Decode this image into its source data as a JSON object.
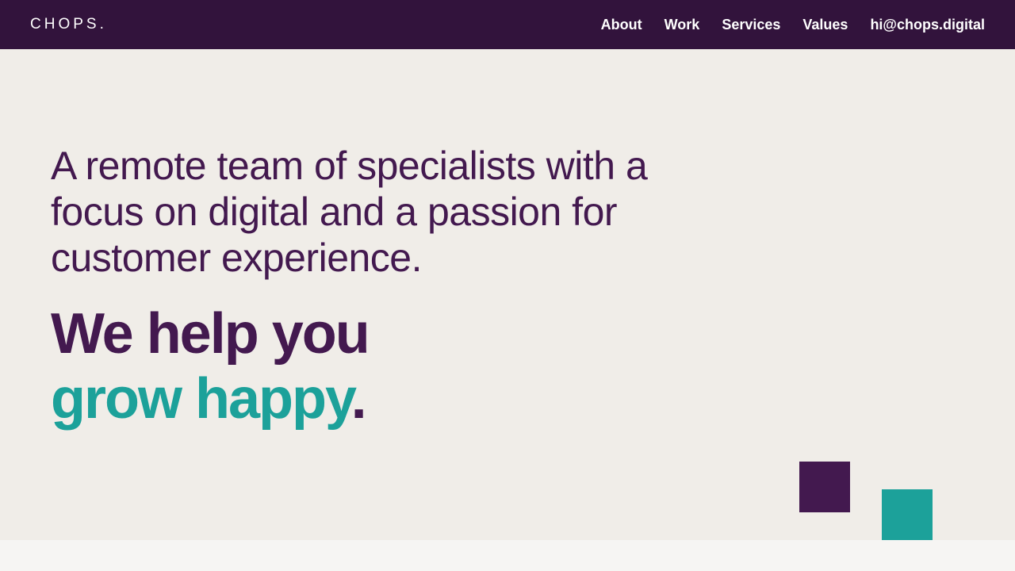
{
  "header": {
    "logo": "CHOPS.",
    "nav": [
      {
        "label": "About"
      },
      {
        "label": "Work"
      },
      {
        "label": "Services"
      },
      {
        "label": "Values"
      },
      {
        "label": "hi@chops.digital"
      }
    ]
  },
  "hero": {
    "intro": "A remote team of specialists with a focus on digital and a passion for customer experience.",
    "tagline_line1": "We help you",
    "tagline_line2_highlight": "grow happy",
    "tagline_line2_end": "."
  },
  "colors": {
    "header_bg": "#32133c",
    "hero_bg": "#f0ede8",
    "purple": "#43194f",
    "teal": "#1ca19a",
    "page_bg": "#f6f5f3"
  }
}
